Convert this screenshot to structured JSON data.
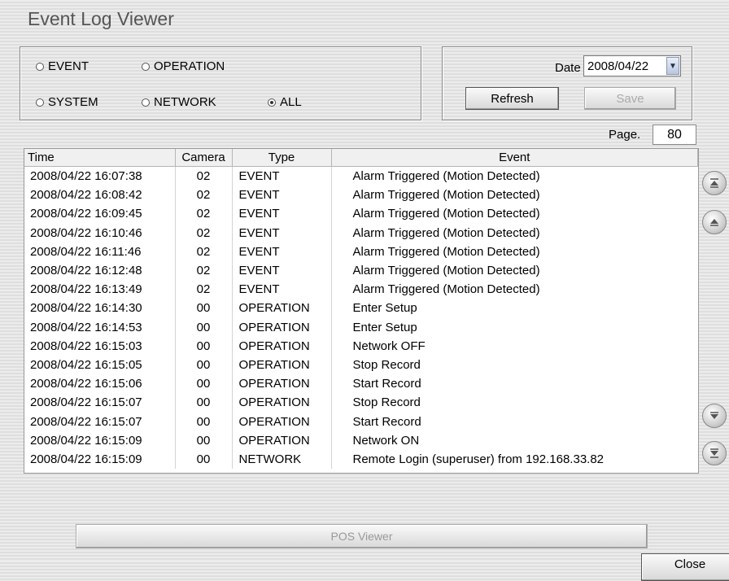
{
  "window": {
    "title": "Event Log Viewer"
  },
  "filters": {
    "options": [
      {
        "label": "EVENT",
        "checked": false
      },
      {
        "label": "OPERATION",
        "checked": false
      },
      {
        "label": "SYSTEM",
        "checked": false
      },
      {
        "label": "NETWORK",
        "checked": false
      },
      {
        "label": "ALL",
        "checked": true
      }
    ]
  },
  "date": {
    "label": "Date",
    "value": "2008/04/22"
  },
  "buttons": {
    "refresh": "Refresh",
    "save": "Save",
    "pos_viewer": "POS Viewer",
    "close": "Close"
  },
  "page": {
    "label": "Page.",
    "value": "80"
  },
  "table": {
    "columns": [
      "Time",
      "Camera",
      "Type",
      "Event"
    ],
    "rows": [
      [
        "2008/04/22 16:07:38",
        "02",
        "EVENT",
        "Alarm Triggered (Motion Detected)"
      ],
      [
        "2008/04/22 16:08:42",
        "02",
        "EVENT",
        "Alarm Triggered (Motion Detected)"
      ],
      [
        "2008/04/22 16:09:45",
        "02",
        "EVENT",
        "Alarm Triggered (Motion Detected)"
      ],
      [
        "2008/04/22 16:10:46",
        "02",
        "EVENT",
        "Alarm Triggered (Motion Detected)"
      ],
      [
        "2008/04/22 16:11:46",
        "02",
        "EVENT",
        "Alarm Triggered (Motion Detected)"
      ],
      [
        "2008/04/22 16:12:48",
        "02",
        "EVENT",
        "Alarm Triggered (Motion Detected)"
      ],
      [
        "2008/04/22 16:13:49",
        "02",
        "EVENT",
        "Alarm Triggered (Motion Detected)"
      ],
      [
        "2008/04/22 16:14:30",
        "00",
        "OPERATION",
        "Enter Setup"
      ],
      [
        "2008/04/22 16:14:53",
        "00",
        "OPERATION",
        "Enter Setup"
      ],
      [
        "2008/04/22 16:15:03",
        "00",
        "OPERATION",
        "Network OFF"
      ],
      [
        "2008/04/22 16:15:05",
        "00",
        "OPERATION",
        "Stop Record"
      ],
      [
        "2008/04/22 16:15:06",
        "00",
        "OPERATION",
        "Start Record"
      ],
      [
        "2008/04/22 16:15:07",
        "00",
        "OPERATION",
        "Stop Record"
      ],
      [
        "2008/04/22 16:15:07",
        "00",
        "OPERATION",
        "Start Record"
      ],
      [
        "2008/04/22 16:15:09",
        "00",
        "OPERATION",
        "Network ON"
      ],
      [
        "2008/04/22 16:15:09",
        "00",
        "NETWORK",
        "Remote Login (superuser) from 192.168.33.82"
      ]
    ]
  },
  "nav_icons": [
    "first-page-icon",
    "prev-page-icon",
    "next-page-icon",
    "last-page-icon"
  ]
}
